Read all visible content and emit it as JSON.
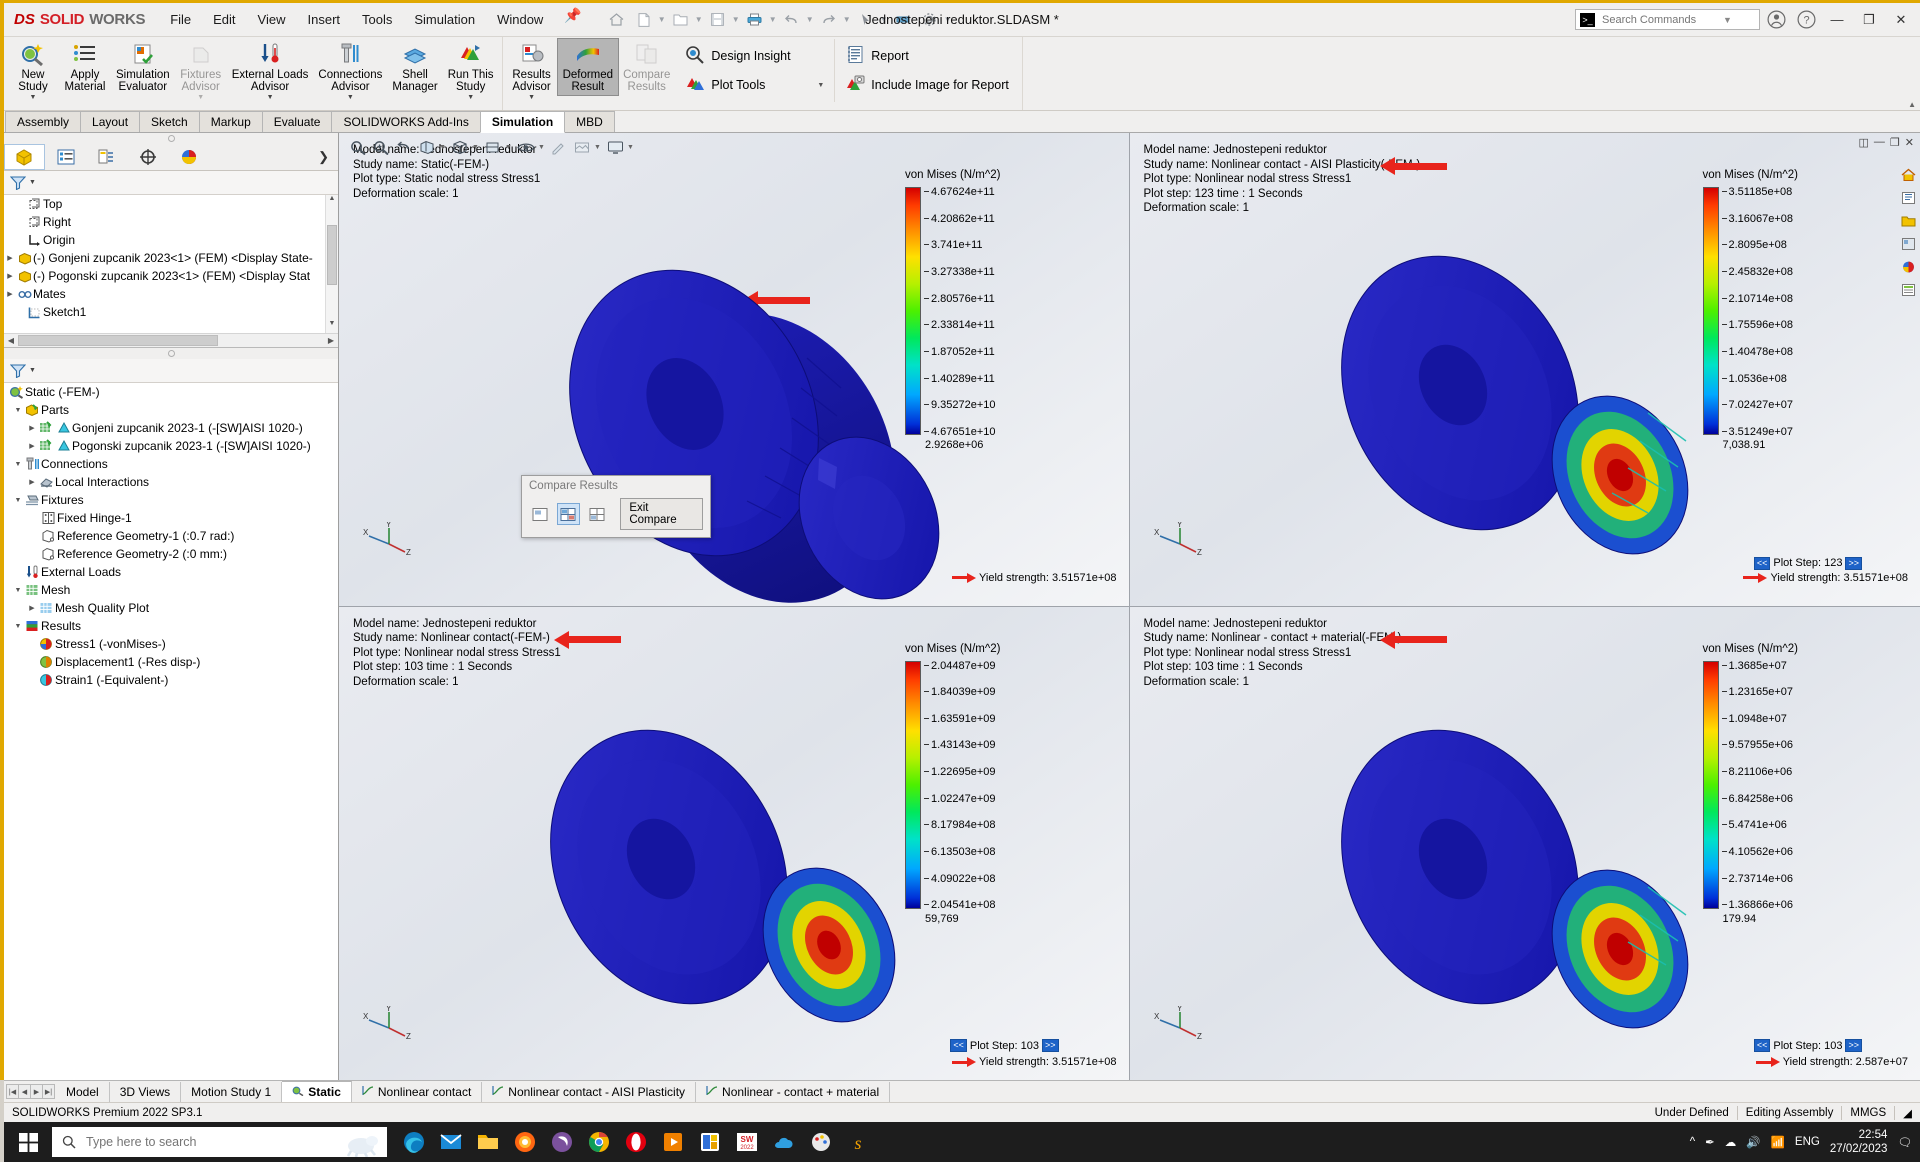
{
  "titlebar": {
    "logo_ds": "DS",
    "logo_solid": "SOLID",
    "logo_works": "WORKS",
    "menu": [
      "File",
      "Edit",
      "View",
      "Insert",
      "Tools",
      "Simulation",
      "Window"
    ],
    "document_title": "Jednostepeni reduktor.SLDASM *",
    "search_placeholder": "Search Commands",
    "quick_access": [
      "home-icon",
      "new-icon",
      "open-icon",
      "save-icon",
      "print-icon",
      "undo-icon",
      "redo-icon",
      "select-icon",
      "measure-icon",
      "options-icon"
    ]
  },
  "ribbon": {
    "buttons": [
      {
        "label": "New\nStudy",
        "icon": "new-study-icon",
        "has_dropdown": true,
        "disabled": false,
        "active": false
      },
      {
        "label": "Apply\nMaterial",
        "icon": "apply-material-icon",
        "has_dropdown": false,
        "disabled": false,
        "active": false
      },
      {
        "label": "Simulation\nEvaluator",
        "icon": "simulation-evaluator-icon",
        "has_dropdown": false,
        "disabled": false,
        "active": false
      },
      {
        "label": "Fixtures\nAdvisor",
        "icon": "fixtures-advisor-icon",
        "has_dropdown": true,
        "disabled": true,
        "active": false
      },
      {
        "label": "External Loads\nAdvisor",
        "icon": "external-loads-advisor-icon",
        "has_dropdown": true,
        "disabled": false,
        "active": false
      },
      {
        "label": "Connections\nAdvisor",
        "icon": "connections-advisor-icon",
        "has_dropdown": true,
        "disabled": false,
        "active": false
      },
      {
        "label": "Shell\nManager",
        "icon": "shell-manager-icon",
        "has_dropdown": false,
        "disabled": false,
        "active": false
      },
      {
        "label": "Run This\nStudy",
        "icon": "run-this-study-icon",
        "has_dropdown": true,
        "disabled": false,
        "active": false
      },
      {
        "label": "Results\nAdvisor",
        "icon": "results-advisor-icon",
        "has_dropdown": true,
        "disabled": false,
        "active": false
      },
      {
        "label": "Deformed\nResult",
        "icon": "deformed-result-icon",
        "has_dropdown": false,
        "disabled": false,
        "active": true
      },
      {
        "label": "Compare\nResults",
        "icon": "compare-results-icon",
        "has_dropdown": false,
        "disabled": true,
        "active": false
      }
    ],
    "small_group_1": [
      {
        "label": "Design Insight",
        "icon": "design-insight-icon",
        "has_dropdown": false
      },
      {
        "label": "Plot Tools",
        "icon": "plot-tools-icon",
        "has_dropdown": true
      }
    ],
    "small_group_2": [
      {
        "label": "Report",
        "icon": "report-icon",
        "has_dropdown": false
      },
      {
        "label": "Include Image for Report",
        "icon": "include-image-icon",
        "has_dropdown": false
      }
    ]
  },
  "command_tabs": {
    "items": [
      "Assembly",
      "Layout",
      "Sketch",
      "Markup",
      "Evaluate",
      "SOLIDWORKS Add-Ins",
      "Simulation",
      "MBD"
    ],
    "selected": "Simulation"
  },
  "sidebar": {
    "tree_tabs": [
      "feature-manager-icon",
      "property-manager-icon",
      "configuration-manager-icon",
      "dimxpert-icon",
      "appearances-icon"
    ],
    "selected_tree_tab": 0,
    "feature_tree": [
      {
        "label": "Top",
        "icon": "plane-icon",
        "indent": 1,
        "arrow": false
      },
      {
        "label": "Right",
        "icon": "plane-icon",
        "indent": 1,
        "arrow": false
      },
      {
        "label": "Origin",
        "icon": "origin-icon",
        "indent": 1,
        "arrow": false
      },
      {
        "label": "(-) Gonjeni zupcanik 2023<1>  (FEM) <Display State-",
        "icon": "part-icon",
        "indent": 0,
        "arrow": true
      },
      {
        "label": "(-) Pogonski zupcanik 2023<1>  (FEM) <Display Stat",
        "icon": "part-icon",
        "indent": 0,
        "arrow": true
      },
      {
        "label": "Mates",
        "icon": "mates-icon",
        "indent": 0,
        "arrow": true
      },
      {
        "label": "Sketch1",
        "icon": "sketch-icon",
        "indent": 1,
        "arrow": false
      }
    ],
    "study_tree": [
      {
        "label": "Static (-FEM-)",
        "icon": "study-icon",
        "indent": 0,
        "arrow": false
      },
      {
        "label": "Parts",
        "icon": "parts-folder-icon",
        "indent": 1,
        "arrow": true,
        "expanded": true
      },
      {
        "label": "Gonjeni zupcanik 2023-1 (-[SW]AISI 1020-)",
        "icon": "mesh-part-icon",
        "indent": 2,
        "arrow": true
      },
      {
        "label": "Pogonski zupcanik 2023-1 (-[SW]AISI 1020-)",
        "icon": "mesh-part-icon",
        "indent": 2,
        "arrow": true
      },
      {
        "label": "Connections",
        "icon": "connections-icon",
        "indent": 1,
        "arrow": true,
        "expanded": true
      },
      {
        "label": "Local Interactions",
        "icon": "local-interactions-icon",
        "indent": 2,
        "arrow": true
      },
      {
        "label": "Fixtures",
        "icon": "fixtures-icon",
        "indent": 1,
        "arrow": true,
        "expanded": true
      },
      {
        "label": "Fixed Hinge-1",
        "icon": "fixed-hinge-icon",
        "indent": 3,
        "arrow": false
      },
      {
        "label": "Reference Geometry-1 (:0.7 rad:)",
        "icon": "reference-geometry-icon",
        "indent": 3,
        "arrow": false
      },
      {
        "label": "Reference Geometry-2 (:0 mm:)",
        "icon": "reference-geometry-icon",
        "indent": 3,
        "arrow": false
      },
      {
        "label": "External Loads",
        "icon": "external-loads-icon",
        "indent": 1,
        "arrow": false
      },
      {
        "label": "Mesh",
        "icon": "mesh-icon",
        "indent": 1,
        "arrow": true,
        "expanded": true
      },
      {
        "label": "Mesh Quality Plot",
        "icon": "mesh-quality-icon",
        "indent": 2,
        "arrow": true
      },
      {
        "label": "Results",
        "icon": "results-icon",
        "indent": 1,
        "arrow": true,
        "expanded": true
      },
      {
        "label": "Stress1 (-vonMises-)",
        "icon": "stress-plot-icon",
        "indent": 2,
        "arrow": false
      },
      {
        "label": "Displacement1 (-Res disp-)",
        "icon": "displacement-plot-icon",
        "indent": 2,
        "arrow": false
      },
      {
        "label": "Strain1 (-Equivalent-)",
        "icon": "strain-plot-icon",
        "indent": 2,
        "arrow": false
      }
    ]
  },
  "compare_dialog": {
    "title": "Compare Results",
    "buttons": [
      "compare-1-icon",
      "compare-2-icon",
      "compare-4-icon"
    ],
    "active_button_index": 1,
    "exit_label": "Exit Compare"
  },
  "viewports": [
    {
      "model_name": "Model name: Jednostepeni reduktor",
      "study_name": "Study name: Static(-FEM-)",
      "plot_type": "Plot type: Static nodal stress Stress1",
      "plot_step": null,
      "deformation_scale": "Deformation scale: 1",
      "legend_title": "von Mises (N/m^2)",
      "legend_values": [
        "4.67624e+11",
        "4.20862e+11",
        "3.741e+11",
        "3.27338e+11",
        "2.80576e+11",
        "2.33814e+11",
        "1.87052e+11",
        "1.40289e+11",
        "9.35272e+10",
        "4.67651e+10",
        "2.9268e+06"
      ],
      "yield_strength": "Yield strength: 3.51571e+08",
      "plot_step_nav": null
    },
    {
      "model_name": "Model name: Jednostepeni reduktor",
      "study_name": "Study name: Nonlinear contact - AISI Plasticity(-FEM-)",
      "plot_type": "Plot type: Nonlinear nodal stress Stress1",
      "plot_step": "Plot step: 123   time : 1 Seconds",
      "deformation_scale": "Deformation scale: 1",
      "legend_title": "von Mises (N/m^2)",
      "legend_values": [
        "3.51185e+08",
        "3.16067e+08",
        "2.8095e+08",
        "2.45832e+08",
        "2.10714e+08",
        "1.75596e+08",
        "1.40478e+08",
        "1.0536e+08",
        "7.02427e+07",
        "3.51249e+07",
        "7,038.91"
      ],
      "yield_strength": "Yield strength: 3.51571e+08",
      "plot_step_nav": "Plot Step: 123"
    },
    {
      "model_name": "Model name: Jednostepeni reduktor",
      "study_name": "Study name: Nonlinear contact(-FEM-)",
      "plot_type": "Plot type: Nonlinear nodal stress Stress1",
      "plot_step": "Plot step: 103   time : 1 Seconds",
      "deformation_scale": "Deformation scale: 1",
      "legend_title": "von Mises (N/m^2)",
      "legend_values": [
        "2.04487e+09",
        "1.84039e+09",
        "1.63591e+09",
        "1.43143e+09",
        "1.22695e+09",
        "1.02247e+09",
        "8.17984e+08",
        "6.13503e+08",
        "4.09022e+08",
        "2.04541e+08",
        "59,769"
      ],
      "yield_strength": "Yield strength: 3.51571e+08",
      "plot_step_nav": "Plot Step: 103"
    },
    {
      "model_name": "Model name: Jednostepeni reduktor",
      "study_name": "Study name: Nonlinear - contact + material(-FEM-)",
      "plot_type": "Plot type: Nonlinear nodal stress Stress1",
      "plot_step": "Plot step: 103   time : 1 Seconds",
      "deformation_scale": "Deformation scale: 1",
      "legend_title": "von Mises (N/m^2)",
      "legend_values": [
        "1.3685e+07",
        "1.23165e+07",
        "1.0948e+07",
        "9.57955e+06",
        "8.21106e+06",
        "6.84258e+06",
        "5.4741e+06",
        "4.10562e+06",
        "2.73714e+06",
        "1.36866e+06",
        "179.94"
      ],
      "yield_strength": "Yield strength: 2.587e+07",
      "plot_step_nav": "Plot Step: 103"
    }
  ],
  "triad_labels": [
    "X",
    "Y",
    "Z"
  ],
  "doc_tabs": {
    "items": [
      {
        "label": "Model",
        "icon": null,
        "selected": false
      },
      {
        "label": "3D Views",
        "icon": null,
        "selected": false
      },
      {
        "label": "Motion Study 1",
        "icon": null,
        "selected": false
      },
      {
        "label": "Static",
        "icon": "study-tab-icon",
        "selected": true
      },
      {
        "label": "Nonlinear contact",
        "icon": "nonlinear-tab-icon",
        "selected": false
      },
      {
        "label": "Nonlinear contact - AISI Plasticity",
        "icon": "nonlinear-tab-icon",
        "selected": false
      },
      {
        "label": "Nonlinear - contact + material",
        "icon": "nonlinear-tab-icon",
        "selected": false
      }
    ]
  },
  "statusbar": {
    "left": "SOLIDWORKS Premium 2022 SP3.1",
    "state": "Under Defined",
    "mode": "Editing Assembly",
    "units": "MMGS"
  },
  "taskbar": {
    "search_placeholder": "Type here to search",
    "apps": [
      "edge-icon",
      "mail-icon",
      "file-explorer-icon",
      "firefox-icon",
      "viber-icon",
      "chrome-icon",
      "opera-icon",
      "media-player-icon",
      "store-icon",
      "solidworks-icon",
      "onedrive-icon",
      "paint-icon",
      "s-app-icon",
      "sw-icon"
    ],
    "tray": [
      "pen-icon",
      "onedrive-tray-icon",
      "speaker-icon",
      "network-icon"
    ],
    "language": "ENG",
    "time": "22:54",
    "date": "27/02/2023"
  },
  "colors": {
    "accent_yellow": "#e0a800",
    "red_arrow": "#e8241c",
    "plot_step_blue": "#1e63c8",
    "selected_tab_bg": "#ffffff"
  }
}
